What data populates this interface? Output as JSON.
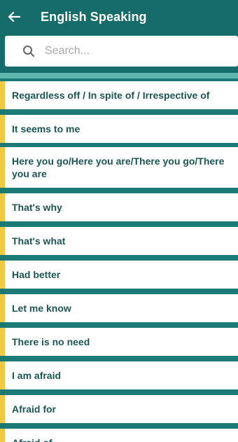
{
  "header": {
    "title": "English Speaking",
    "back_icon": "arrow-left-icon"
  },
  "search": {
    "placeholder": "Search...",
    "icon": "search-icon"
  },
  "colors": {
    "app_bar": "#156c68",
    "background": "#1c7a74",
    "accent_bar": "#f2c744",
    "item_text": "#1a5653"
  },
  "phrases": [
    "Regardless off / In spite of / Irrespective of",
    "It seems to me",
    "Here you go/Here you are/There you go/There you are",
    "That's why",
    "That's what",
    "Had better",
    "Let me know",
    "There is no need",
    "I am afraid",
    "Afraid for",
    "Afraid of"
  ]
}
